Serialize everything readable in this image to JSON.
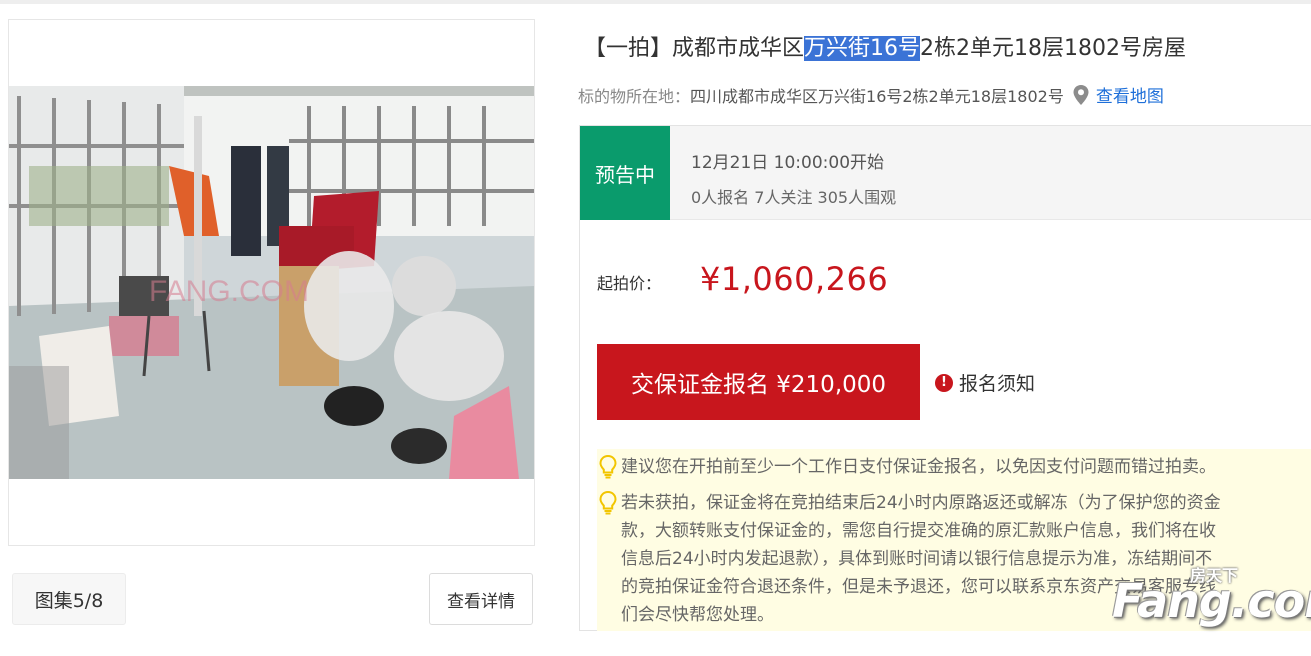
{
  "listing": {
    "title_prefix": "【一拍】成都市成华区",
    "title_highlight": "万兴街16号",
    "title_suffix": "2栋2单元18层1802号房屋",
    "address_label": "标的物所在地：",
    "address": "四川成都市成华区万兴街16号2栋2单元18层1802号",
    "map_link": "查看地图"
  },
  "gallery": {
    "album_label": "图集5/8",
    "detail_button": "查看详情",
    "photo_watermark": "FANG.COM"
  },
  "auction": {
    "status": "预告中",
    "start_time": "12月21日 10:00:00开始",
    "counts": "0人报名  7人关注  305人围观",
    "price_label": "起拍价：",
    "price_value": "¥1,060,266",
    "deposit_button": "交保证金报名 ¥210,000",
    "notice_label": "报名须知",
    "notice_icon": "!"
  },
  "tips": {
    "tip1": "建议您在开拍前至少一个工作日支付保证金报名，以免因支付问题而错过拍卖。",
    "tip2_lines": [
      "若未获拍，保证金将在竞拍结束后24小时内原路返还或解冻（为了保护您的资金",
      "款，大额转账支付保证金的，需您自行提交准确的原汇款账户信息，我们将在收",
      "信息后24小时内发起退款），具体到账时间请以银行信息提示为准，冻结期间不",
      "的竞拍保证金符合退还条件，但是未予退还，您可以联系京东资产交易客服专线",
      "们会尽快帮您处理。"
    ]
  },
  "watermark": {
    "top_text": "房天下",
    "main_text": "Fang.com"
  },
  "colors": {
    "status_green": "#0a9b6c",
    "price_red": "#c8161d",
    "link_blue": "#1e6fd9",
    "tips_bg": "#fffde3"
  }
}
